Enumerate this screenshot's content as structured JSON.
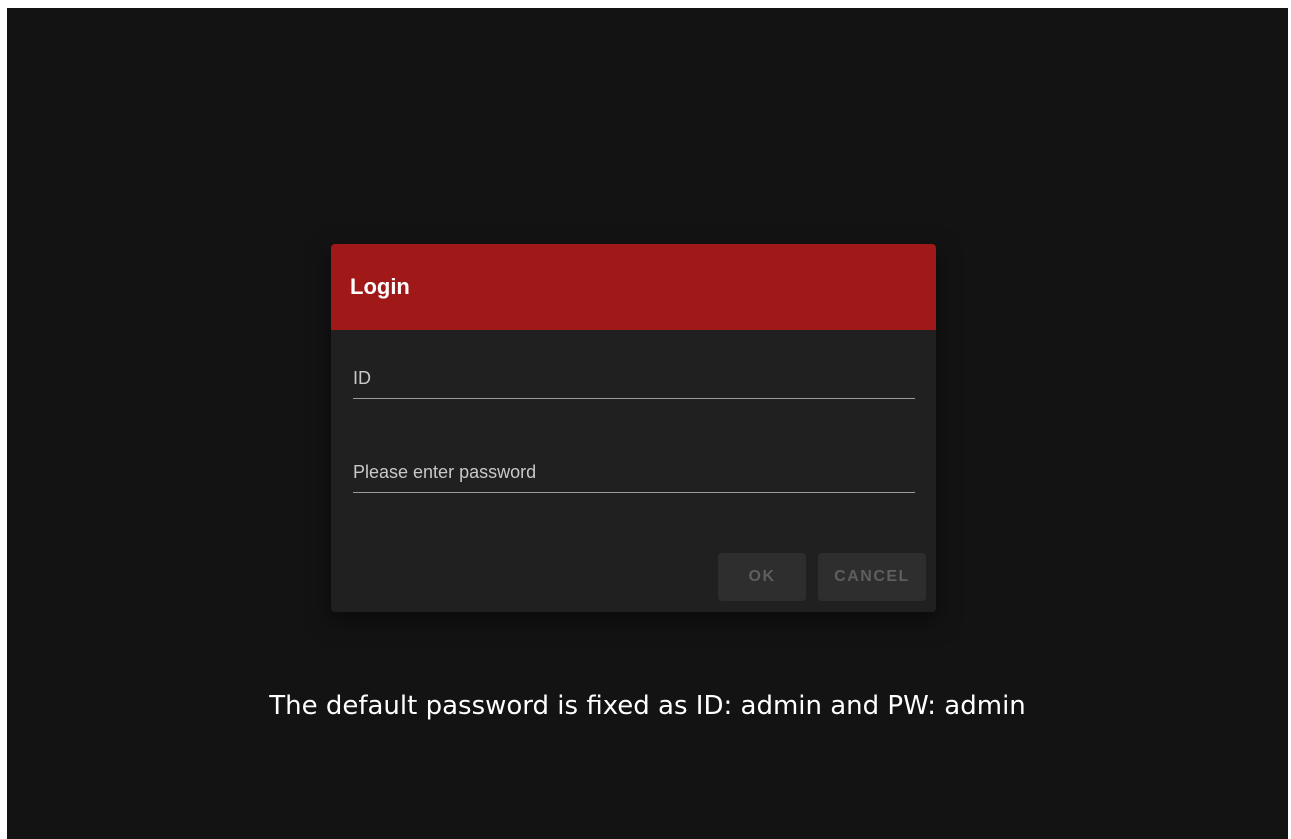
{
  "dialog": {
    "title": "Login",
    "id_field": {
      "placeholder": "ID",
      "value": ""
    },
    "password_field": {
      "placeholder": "Please enter password",
      "value": ""
    },
    "ok_label": "OK",
    "cancel_label": "CANCEL"
  },
  "note": "The default password is fixed as ID: admin and PW: admin",
  "colors": {
    "background": "#131313",
    "dialog_body": "#202020",
    "header_accent": "#a01817",
    "button_disabled_bg": "#2e2e2e",
    "button_disabled_text": "#5e5e5e"
  }
}
